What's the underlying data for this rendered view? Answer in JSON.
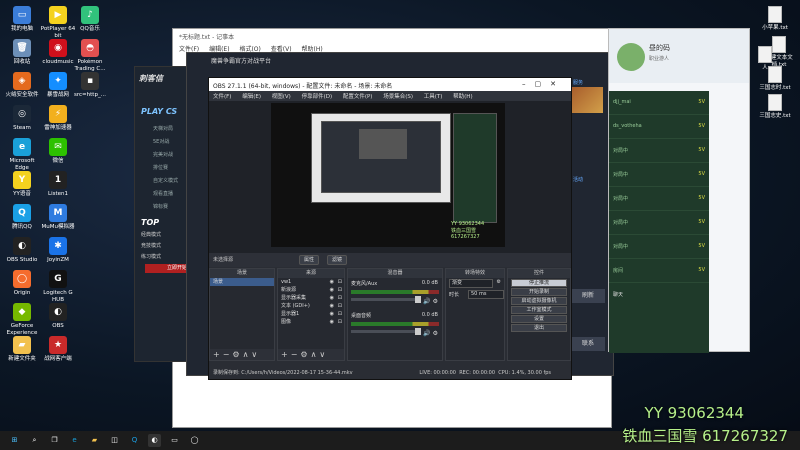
{
  "desktop_icons": [
    {
      "label": "我的电脑",
      "color": "#3b7dd8",
      "glyph": "▭"
    },
    {
      "label": "PotPlayer 64 bit",
      "color": "#f4d21f",
      "glyph": "▶"
    },
    {
      "label": "QQ音乐",
      "color": "#31c27c",
      "glyph": "♪"
    },
    {
      "label": "回收站",
      "color": "#6c8fb8",
      "glyph": "🗑"
    },
    {
      "label": "cloudmusic",
      "color": "#d0101c",
      "glyph": "◉"
    },
    {
      "label": "Pokémon Trading C...",
      "color": "#e25050",
      "glyph": "◓"
    },
    {
      "label": "火绒安全软件",
      "color": "#e46a1e",
      "glyph": "◈"
    },
    {
      "label": "暴雪战网",
      "color": "#148eff",
      "glyph": "✦"
    },
    {
      "label": "src=http_...",
      "color": "#333",
      "glyph": "▪"
    },
    {
      "label": "Steam",
      "color": "#1b2838",
      "glyph": "◎"
    },
    {
      "label": "雷神加速器",
      "color": "#f2b01e",
      "glyph": "⚡"
    },
    {
      "label": "Microsoft Edge",
      "color": "#1aa0d8",
      "glyph": "e"
    },
    {
      "label": "微信",
      "color": "#2dc100",
      "glyph": "✉"
    },
    {
      "label": "YY语音",
      "color": "#f4d21f",
      "glyph": "Y"
    },
    {
      "label": "Listen1",
      "color": "#222",
      "glyph": "1"
    },
    {
      "label": "腾讯QQ",
      "color": "#1aa0e6",
      "glyph": "Q"
    },
    {
      "label": "MuMu模拟器",
      "color": "#2e7be0",
      "glyph": "M"
    },
    {
      "label": "OBS Studio",
      "color": "#222",
      "glyph": "◐"
    },
    {
      "label": "JoyinZM",
      "color": "#1a73e8",
      "glyph": "✱"
    },
    {
      "label": "Origin",
      "color": "#f56c2d",
      "glyph": "◯"
    },
    {
      "label": "Logitech G HUB",
      "color": "#111",
      "glyph": "G"
    },
    {
      "label": "GeForce Experience",
      "color": "#76b900",
      "glyph": "◆"
    },
    {
      "label": "OBS",
      "color": "#222",
      "glyph": "◐"
    },
    {
      "label": "新建文件夹",
      "color": "#f2c14e",
      "glyph": "▰"
    },
    {
      "label": "战网客户端",
      "color": "#c92a2a",
      "glyph": "★"
    }
  ],
  "right_icons": [
    {
      "label": "小苹果.txt"
    },
    {
      "label": "新建文本文档.txt"
    },
    {
      "label": "人"
    },
    {
      "label": "三国志时.txt"
    },
    {
      "label": "三国志史.txt"
    }
  ],
  "notepad": {
    "title": "*无标题.txt - 记事本",
    "menu": [
      "文件(F)",
      "编辑(E)",
      "格式(O)",
      "查看(V)",
      "帮助(H)"
    ]
  },
  "launcher": {
    "logo": "刺客信",
    "play": "PLAY CS",
    "items": [
      "天梯对局",
      "5E对战",
      "完美对战",
      "排位赛",
      "自定义模式",
      "观看直播",
      "锦标赛"
    ],
    "top_label": "TOP",
    "sections": [
      "经典模式",
      "竞技模式",
      "练习模式"
    ],
    "red_button": "立即开始"
  },
  "server_window": {
    "title": "魔兽争霸官方对战平台",
    "right_links": [
      "服务",
      "活动"
    ],
    "side_button": "刷新",
    "bottom_button": "联系"
  },
  "chat": {
    "name": "昼的码",
    "subtitle": "职业游人",
    "rows": [
      {
        "text": "djj_mai",
        "tag": "5V"
      },
      {
        "text": "ds_votheha",
        "tag": "5V"
      },
      {
        "text": "对局中",
        "tag": "5V"
      },
      {
        "text": "对局中",
        "tag": "5V"
      },
      {
        "text": "对局中",
        "tag": "5V"
      },
      {
        "text": "对局中",
        "tag": "5V"
      },
      {
        "text": "对局中",
        "tag": "5V"
      },
      {
        "text": "房间",
        "tag": "5V"
      }
    ],
    "bottom_label": "聊天"
  },
  "obs": {
    "title": "OBS 27.1.1 (64-bit, windows) - 配置文件: 未命名 - 场景: 未命名",
    "menu": [
      "文件(F)",
      "编辑(E)",
      "视图(V)",
      "停靠部件(D)",
      "配置文件(P)",
      "场景集合(S)",
      "工具(T)",
      "帮助(H)"
    ],
    "no_scene_label": "未选择源",
    "pills": [
      "属性",
      "滤镜"
    ],
    "docks": {
      "scenes": "场景",
      "sources": "来源",
      "mixer": "混音器",
      "transitions": "转场特效",
      "controls": "控件"
    },
    "scenes": [
      "场景"
    ],
    "sources": [
      "vw1",
      "新浪源",
      "显示器采集",
      "文本 (GDI+)",
      "显示器1",
      "图像"
    ],
    "mixer": [
      {
        "name": "麦克风/Aux",
        "db": "0.0 dB"
      },
      {
        "name": "桌面音频",
        "db": "0.0 dB"
      }
    ],
    "transitions": {
      "type_label": "渐变",
      "duration_label": "时长",
      "duration_value": "50 ms"
    },
    "controls": [
      "停止推流",
      "开始录制",
      "启动虚拟摄像机",
      "工作室模式",
      "设置",
      "退出"
    ],
    "status": {
      "recording_path": "录制保存到: C:/Users/h/Videos/2022-08-17 15-36-44.mkv",
      "live": "LIVE: 00:00:00",
      "rec": "REC: 00:00:00",
      "cpu": "CPU: 1.4%, 30.00 fps"
    }
  },
  "watermark": {
    "line1": "YY 93062344",
    "line2": "铁血三国雪 617267327"
  },
  "taskbar": {
    "icons": [
      "windows-start",
      "search",
      "taskview",
      "edge",
      "explorer",
      "store",
      "qq",
      "obs"
    ]
  }
}
